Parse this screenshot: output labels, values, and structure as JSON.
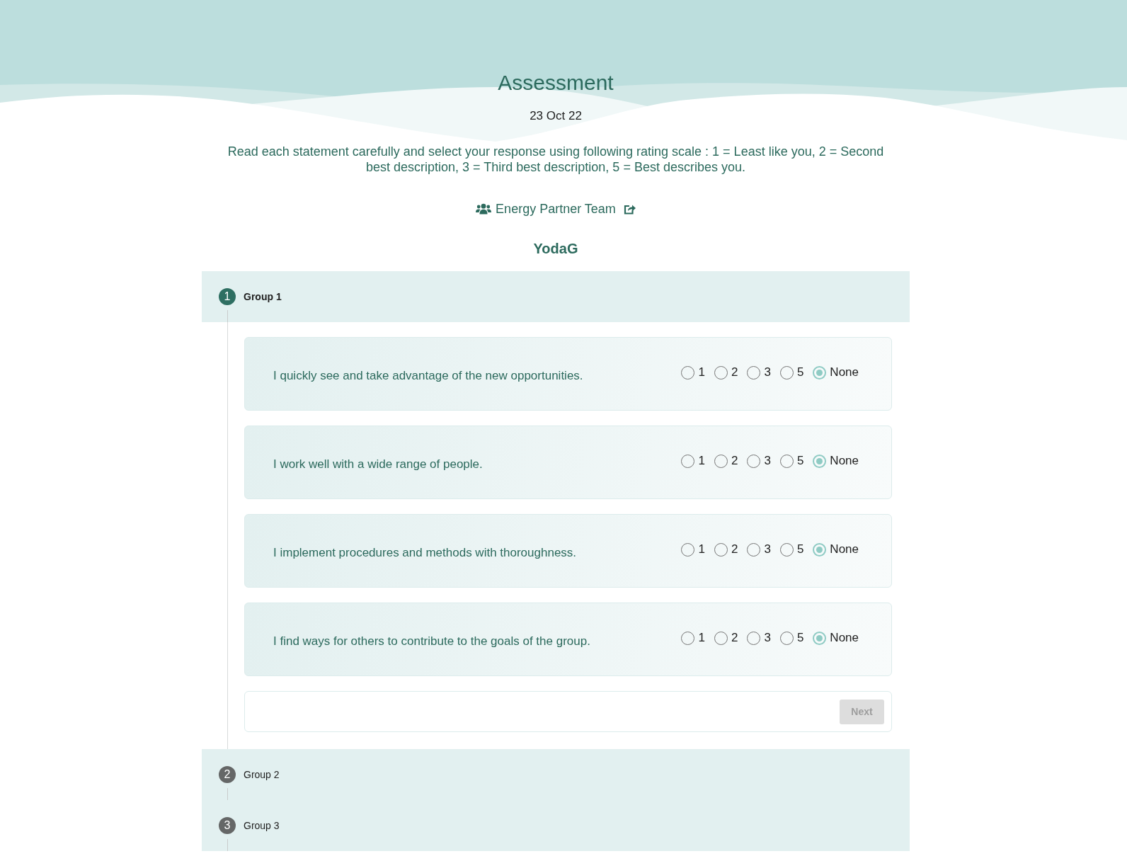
{
  "header": {
    "title": "Assessment",
    "date": "23 Oct 22",
    "instructions": "Read each statement carefully and select your response using following rating scale : 1 = Least like you, 2 = Second best description, 3 = Third best description, 5 = Best describes you."
  },
  "team": {
    "name": "Energy Partner Team"
  },
  "participant": {
    "name": "YodaG"
  },
  "groups": [
    {
      "number": "1",
      "label": "Group 1",
      "expanded": true,
      "questions": [
        {
          "text": "I quickly see and take advantage of the new opportunities.",
          "options": [
            {
              "label": "1",
              "selected": false
            },
            {
              "label": "2",
              "selected": false
            },
            {
              "label": "3",
              "selected": false
            },
            {
              "label": "5",
              "selected": false
            },
            {
              "label": "None",
              "selected": true
            }
          ]
        },
        {
          "text": "I work well with a wide range of people.",
          "options": [
            {
              "label": "1",
              "selected": false
            },
            {
              "label": "2",
              "selected": false
            },
            {
              "label": "3",
              "selected": false
            },
            {
              "label": "5",
              "selected": false
            },
            {
              "label": "None",
              "selected": true
            }
          ]
        },
        {
          "text": "I implement procedures and methods with thoroughness.",
          "options": [
            {
              "label": "1",
              "selected": false
            },
            {
              "label": "2",
              "selected": false
            },
            {
              "label": "3",
              "selected": false
            },
            {
              "label": "5",
              "selected": false
            },
            {
              "label": "None",
              "selected": true
            }
          ]
        },
        {
          "text": "I find ways for others to contribute to the goals of the group.",
          "options": [
            {
              "label": "1",
              "selected": false
            },
            {
              "label": "2",
              "selected": false
            },
            {
              "label": "3",
              "selected": false
            },
            {
              "label": "5",
              "selected": false
            },
            {
              "label": "None",
              "selected": true
            }
          ]
        }
      ],
      "next_button": {
        "label": "Next",
        "disabled": true
      }
    },
    {
      "number": "2",
      "label": "Group 2",
      "expanded": false
    },
    {
      "number": "3",
      "label": "Group 3",
      "expanded": false
    }
  ]
}
